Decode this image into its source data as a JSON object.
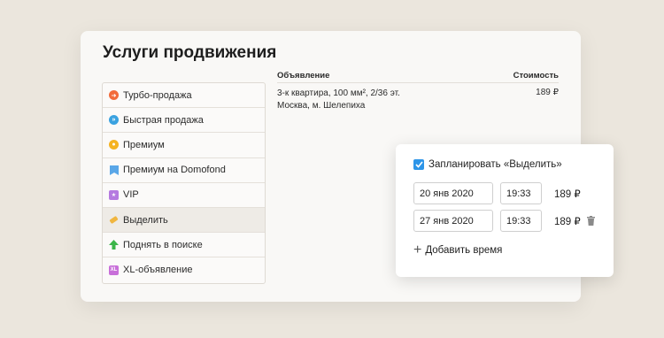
{
  "panel": {
    "title": "Услуги продвижения"
  },
  "menu": {
    "items": [
      {
        "label": "Турбо-продажа",
        "icon": "turbo-icon",
        "color": "#f26b3a"
      },
      {
        "label": "Быстрая продажа",
        "icon": "quick-sale-icon",
        "color": "#3aa2e0"
      },
      {
        "label": "Премиум",
        "icon": "premium-icon",
        "color": "#f5b321"
      },
      {
        "label": "Премиум на Domofond",
        "icon": "domofond-flag-icon",
        "color": "#5aa7e8"
      },
      {
        "label": "VIP",
        "icon": "vip-icon",
        "color": "#b57ae0"
      },
      {
        "label": "Выделить",
        "icon": "highlight-icon",
        "color": "#f0b640",
        "active": true
      },
      {
        "label": "Поднять в поиске",
        "icon": "arrow-up-icon",
        "color": "#3cb64a"
      },
      {
        "label": "XL-объявление",
        "icon": "xl-icon",
        "color": "#c86fd9"
      }
    ]
  },
  "table": {
    "col_ad": "Объявление",
    "col_cost": "Стоимость",
    "ad_line1": "3-к квартира, 100 мм², 2/36 эт.",
    "ad_line2": "Москва, м. Шелепиха",
    "price": "189 ₽"
  },
  "schedule": {
    "label": "Запланировать «Выделить»",
    "checked": true,
    "rows": [
      {
        "date": "20 янв 2020",
        "time": "19:33",
        "price": "189 ₽"
      },
      {
        "date": "27 янв 2020",
        "time": "19:33",
        "price": "189 ₽"
      }
    ],
    "add_label": "Добавить время"
  }
}
